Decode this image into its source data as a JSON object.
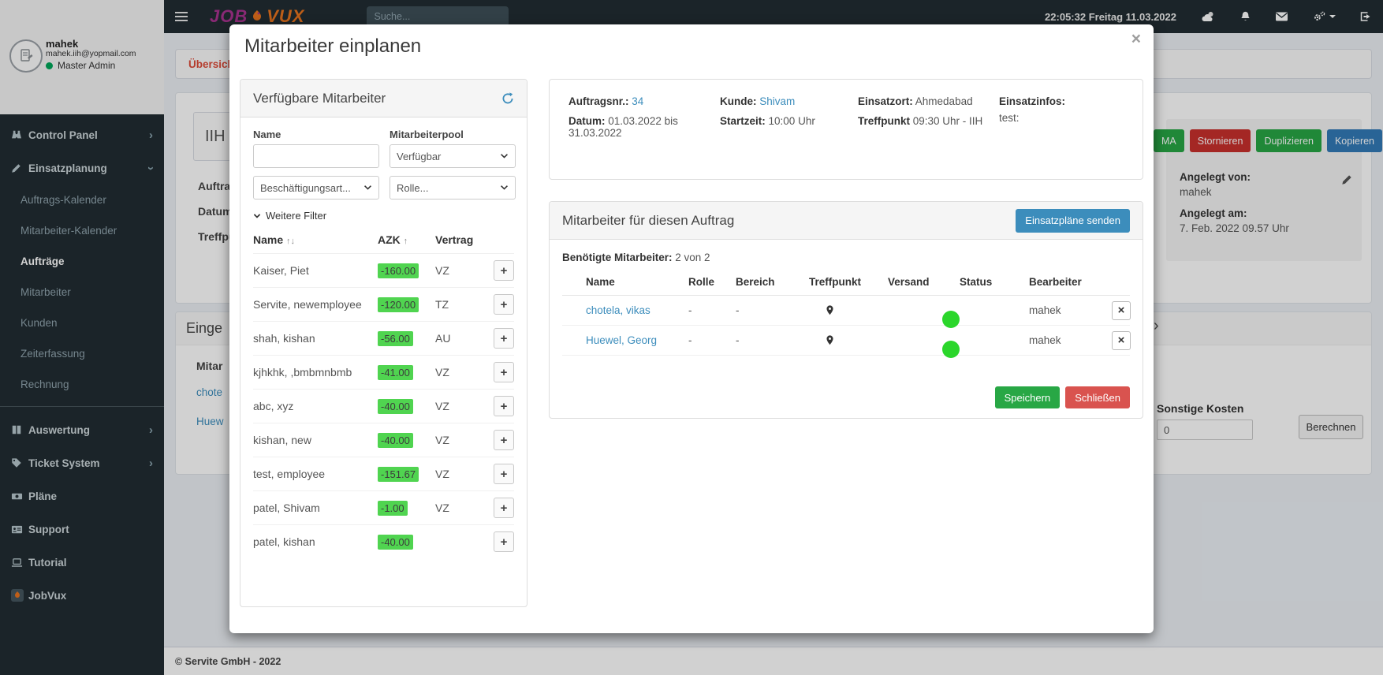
{
  "colors": {
    "accent_blue": "#3c8dbc",
    "navbar_dark": "#222d32",
    "badge_green": "#50d450",
    "toggle_green": "#2bd62b",
    "success_green": "#28a745",
    "danger_red": "#d9534f",
    "cancel_red": "#c9302c",
    "link_blue": "#3c8dbc",
    "tab_red": "#dd4b39",
    "logo_purple": "#a8338f",
    "logo_orange": "#e8731e"
  },
  "icons": {
    "hamburger": "menu-bars",
    "weather": "sun-cloud",
    "bell": "notifications",
    "envelope": "messages",
    "cogs": "settings-gear",
    "signout": "logout-arrow",
    "refresh": "circular-arrows",
    "marker": "map-pin",
    "pencil": "edit",
    "chevron_right": "›",
    "sort_both": "↑↓",
    "sort_up": "↑",
    "bullet": "●"
  },
  "topbar": {
    "logo_part1": "JOB",
    "logo_part2": "VUX",
    "search_placeholder": "Suche...",
    "clock": "22:05:32 Freitag 11.03.2022"
  },
  "sidebar": {
    "user": {
      "name": "mahek",
      "email": "mahek.iih@yopmail.com",
      "status": "Master Admin"
    },
    "items": [
      {
        "label": "Control Panel",
        "icon": "binoculars"
      },
      {
        "label": "Einsatzplanung",
        "icon": "pencil"
      },
      {
        "label": "Auswertung",
        "icon": "book"
      },
      {
        "label": "Ticket System",
        "icon": "tags"
      },
      {
        "label": "Pläne",
        "icon": "banknote"
      },
      {
        "label": "Support",
        "icon": "id-card"
      },
      {
        "label": "Tutorial",
        "icon": "laptop"
      },
      {
        "label": "JobVux",
        "icon": "jobvux-logo"
      }
    ],
    "einsatzplanung_children": [
      "Auftrags-Kalender",
      "Mitarbeiter-Kalender",
      "Aufträge",
      "Mitarbeiter",
      "Kunden",
      "Zeiterfassung",
      "Rechnung"
    ],
    "active_item": "Aufträge"
  },
  "background": {
    "tab": "Übersicht",
    "order_code": "IIH",
    "left_labels": [
      "Auftrag",
      "Datum",
      "Treffpu"
    ],
    "action_buttons": [
      "MA",
      "Stornieren",
      "Duplizieren",
      "Kopieren"
    ],
    "created_by_label": "Angelegt von:",
    "created_by_value": "mahek",
    "created_at_label": "Angelegt am:",
    "created_at_value": "7. Feb. 2022 09.57 Uhr",
    "panel2_title": "Einge",
    "panel2_sub": "Mitar",
    "panel2_links": [
      "chote",
      "Huew"
    ],
    "expand_chevron": "›",
    "costs_label": "Sonstige Kosten",
    "costs_value": "0",
    "calc_button": "Berechnen",
    "footer": "© Servite GmbH - 2022"
  },
  "modal": {
    "title": "Mitarbeiter einplanen",
    "close_glyph": "×",
    "available": {
      "title": "Verfügbare Mitarbeiter",
      "filters": {
        "name_label": "Name",
        "pool_label": "Mitarbeiterpool",
        "pool_value": "Verfügbar",
        "employment_placeholder": "Beschäftigungsart...",
        "role_placeholder": "Rolle...",
        "more_filters": "Weitere Filter"
      },
      "table": {
        "col_name": "Name",
        "col_name_sort": "↑↓",
        "col_azk": "AZK",
        "col_azk_sort": "↑",
        "col_contract": "Vertrag",
        "add_button": "+",
        "rows": [
          {
            "name": "Kaiser, Piet",
            "azk": "-160.00",
            "contract": "VZ"
          },
          {
            "name": "Servite, newemployee",
            "azk": "-120.00",
            "contract": "TZ"
          },
          {
            "name": "shah, kishan",
            "azk": "-56.00",
            "contract": "AU"
          },
          {
            "name": "kjhkhk, ,bmbmnbmb",
            "azk": "-41.00",
            "contract": "VZ"
          },
          {
            "name": "abc, xyz",
            "azk": "-40.00",
            "contract": "VZ"
          },
          {
            "name": "kishan, new",
            "azk": "-40.00",
            "contract": "VZ"
          },
          {
            "name": "test, employee",
            "azk": "-151.67",
            "contract": "VZ"
          },
          {
            "name": "patel, Shivam",
            "azk": "-1.00",
            "contract": "VZ"
          },
          {
            "name": "patel, kishan",
            "azk": "-40.00",
            "contract": ""
          }
        ]
      }
    },
    "order": {
      "col1": {
        "l1": "Auftragsnr.:",
        "v1": "34",
        "l2": "Datum:",
        "v2": "01.03.2022 bis 31.03.2022"
      },
      "col2": {
        "l1": "Kunde:",
        "v1": "Shivam",
        "l2": "Startzeit:",
        "v2": "10:00 Uhr"
      },
      "col3": {
        "l1": "Einsatzort:",
        "v1": "Ahmedabad",
        "l2": "Treffpunkt",
        "v2": "09:30 Uhr - IIH"
      },
      "col4": {
        "l1": "Einsatzinfos:",
        "v2": "test:"
      }
    },
    "assigned": {
      "title": "Mitarbeiter für diesen Auftrag",
      "send_button": "Einsatzpläne senden",
      "required_label": "Benötigte Mitarbeiter:",
      "required_value": "2 von 2",
      "columns": [
        "Name",
        "Rolle",
        "Bereich",
        "Treffpunkt",
        "Versand",
        "Status",
        "Bearbeiter"
      ],
      "rows": [
        {
          "name": "chotela, vikas",
          "role": "-",
          "area": "-",
          "editor": "mahek"
        },
        {
          "name": "Huewel, Georg",
          "role": "-",
          "area": "-",
          "editor": "mahek"
        }
      ],
      "save_button": "Speichern",
      "close_button": "Schließen"
    }
  }
}
